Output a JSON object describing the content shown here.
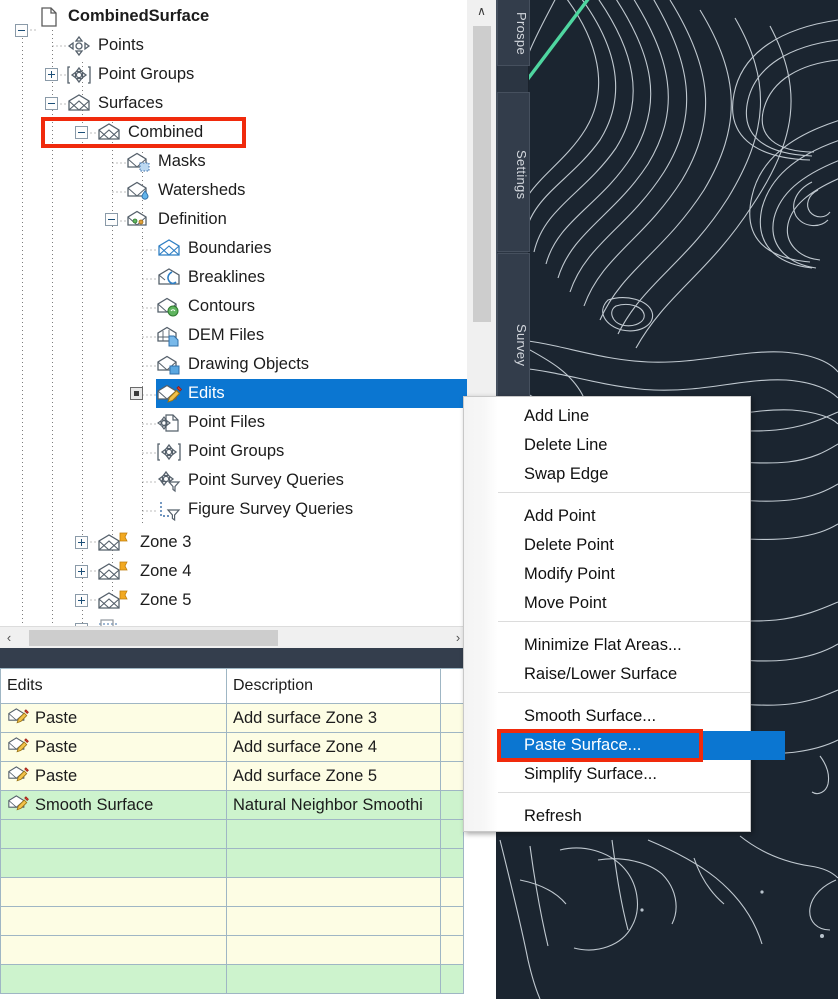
{
  "app": {
    "tabs": [
      {
        "id": "prospector",
        "label": "Prospe",
        "active": false
      },
      {
        "id": "settings",
        "label": "Settings",
        "active": false
      },
      {
        "id": "survey",
        "label": "Survey",
        "active": false
      }
    ],
    "colors": {
      "selection_blue": "#0b76d1",
      "callout_red": "#f02a0c",
      "cad_background": "#1b2530",
      "contour_line": "#d6dde4",
      "accent_green": "#4fd6a0",
      "row_yellow": "#fdfde4",
      "row_green": "#cdf3cd"
    }
  },
  "tree": {
    "root_label": "CombinedSurface",
    "nodes": [
      {
        "label": "CombinedSurface",
        "icon": "drawing-file-icon",
        "expander": "minus",
        "depth": 0,
        "bold": true,
        "selected": false
      },
      {
        "label": "Points",
        "icon": "points-icon",
        "expander": "none",
        "depth": 1,
        "bold": false,
        "selected": false
      },
      {
        "label": "Point Groups",
        "icon": "point-groups-icon",
        "expander": "plus",
        "depth": 1,
        "bold": false,
        "selected": false
      },
      {
        "label": "Surfaces",
        "icon": "surface-icon",
        "expander": "minus",
        "depth": 1,
        "bold": false,
        "selected": false
      },
      {
        "label": "Combined",
        "icon": "surface-icon",
        "expander": "minus",
        "depth": 2,
        "bold": false,
        "selected": false,
        "callout": true
      },
      {
        "label": "Masks",
        "icon": "surface-masks-icon",
        "expander": "none",
        "depth": 3,
        "bold": false,
        "selected": false
      },
      {
        "label": "Watersheds",
        "icon": "surface-watersheds-icon",
        "expander": "none",
        "depth": 3,
        "bold": false,
        "selected": false
      },
      {
        "label": "Definition",
        "icon": "surface-definition-icon",
        "expander": "minus",
        "depth": 3,
        "bold": false,
        "selected": false
      },
      {
        "label": "Boundaries",
        "icon": "boundaries-icon",
        "expander": "none",
        "depth": 4,
        "bold": false,
        "selected": false
      },
      {
        "label": "Breaklines",
        "icon": "breaklines-icon",
        "expander": "none",
        "depth": 4,
        "bold": false,
        "selected": false
      },
      {
        "label": "Contours",
        "icon": "contours-icon",
        "expander": "none",
        "depth": 4,
        "bold": false,
        "selected": false
      },
      {
        "label": "DEM Files",
        "icon": "dem-files-icon",
        "expander": "none",
        "depth": 4,
        "bold": false,
        "selected": false
      },
      {
        "label": "Drawing Objects",
        "icon": "drawing-objects-icon",
        "expander": "none",
        "depth": 4,
        "bold": false,
        "selected": false
      },
      {
        "label": "Edits",
        "icon": "surface-edits-icon",
        "expander": "dot",
        "depth": 4,
        "bold": false,
        "selected": true
      },
      {
        "label": "Point Files",
        "icon": "point-files-icon",
        "expander": "none",
        "depth": 4,
        "bold": false,
        "selected": false
      },
      {
        "label": "Point Groups",
        "icon": "point-groups-icon",
        "expander": "none",
        "depth": 4,
        "bold": false,
        "selected": false
      },
      {
        "label": "Point Survey Queries",
        "icon": "point-survey-query-icon",
        "expander": "none",
        "depth": 4,
        "bold": false,
        "selected": false
      },
      {
        "label": "Figure Survey Queries",
        "icon": "figure-survey-query-icon",
        "expander": "none",
        "depth": 4,
        "bold": false,
        "selected": false
      },
      {
        "label": "Zone 3",
        "icon": "surface-flagged-icon",
        "expander": "plus",
        "depth": 2,
        "bold": false,
        "selected": false
      },
      {
        "label": "Zone 4",
        "icon": "surface-flagged-icon",
        "expander": "plus",
        "depth": 2,
        "bold": false,
        "selected": false
      },
      {
        "label": "Zone 5",
        "icon": "surface-flagged-icon",
        "expander": "plus",
        "depth": 2,
        "bold": false,
        "selected": false
      }
    ],
    "scroll": {
      "up_arrow": "∧",
      "left_arrow": "‹",
      "right_arrow": "›"
    }
  },
  "grid": {
    "columns": [
      "Edits",
      "Description",
      ""
    ],
    "rows": [
      {
        "icon": "surface-edit-icon",
        "edit": "Paste",
        "description": "Add surface Zone 3",
        "tone": "yellow"
      },
      {
        "icon": "surface-edit-icon",
        "edit": "Paste",
        "description": "Add surface Zone 4",
        "tone": "yellow"
      },
      {
        "icon": "surface-edit-icon",
        "edit": "Paste",
        "description": "Add surface Zone 5",
        "tone": "yellow"
      },
      {
        "icon": "surface-edit-icon",
        "edit": "Smooth Surface",
        "description": "Natural Neighbor Smoothi",
        "tone": "green"
      },
      {
        "icon": "",
        "edit": "",
        "description": "",
        "tone": "green"
      },
      {
        "icon": "",
        "edit": "",
        "description": "",
        "tone": "green"
      },
      {
        "icon": "",
        "edit": "",
        "description": "",
        "tone": "yellow"
      },
      {
        "icon": "",
        "edit": "",
        "description": "",
        "tone": "yellow"
      },
      {
        "icon": "",
        "edit": "",
        "description": "",
        "tone": "yellow"
      },
      {
        "icon": "",
        "edit": "",
        "description": "",
        "tone": "green"
      }
    ]
  },
  "context_menu": {
    "groups": [
      {
        "items": [
          {
            "label": "Add Line",
            "highlighted": false,
            "callout": false
          },
          {
            "label": "Delete Line",
            "highlighted": false,
            "callout": false
          },
          {
            "label": "Swap Edge",
            "highlighted": false,
            "callout": false
          }
        ]
      },
      {
        "items": [
          {
            "label": "Add Point",
            "highlighted": false,
            "callout": false
          },
          {
            "label": "Delete Point",
            "highlighted": false,
            "callout": false
          },
          {
            "label": "Modify Point",
            "highlighted": false,
            "callout": false
          },
          {
            "label": "Move Point",
            "highlighted": false,
            "callout": false
          }
        ]
      },
      {
        "items": [
          {
            "label": "Minimize Flat Areas...",
            "highlighted": false,
            "callout": false
          },
          {
            "label": "Raise/Lower Surface",
            "highlighted": false,
            "callout": false
          }
        ]
      },
      {
        "items": [
          {
            "label": "Smooth Surface...",
            "highlighted": false,
            "callout": false
          },
          {
            "label": "Paste Surface...",
            "highlighted": true,
            "callout": true
          },
          {
            "label": "Simplify Surface...",
            "highlighted": false,
            "callout": false
          }
        ]
      },
      {
        "items": [
          {
            "label": "Refresh",
            "highlighted": false,
            "callout": false
          }
        ]
      }
    ]
  }
}
